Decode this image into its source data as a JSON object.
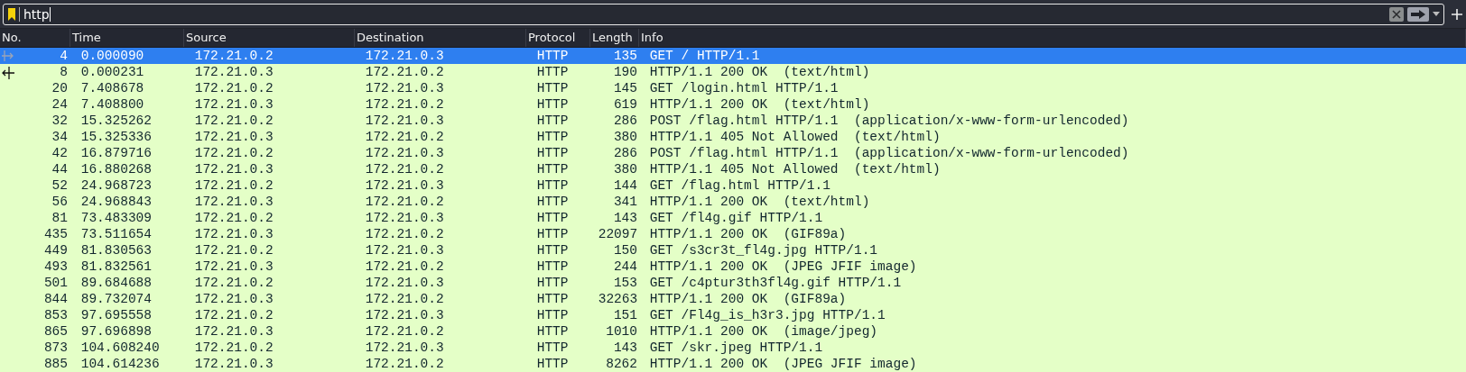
{
  "filter_bar": {
    "value": "http"
  },
  "table": {
    "columns": [
      "No.",
      "Time",
      "Source",
      "Destination",
      "Protocol",
      "Length",
      "Info"
    ],
    "rows": [
      {
        "selected": true,
        "kind": "request",
        "cells": [
          "4",
          "0.000090",
          "172.21.0.2",
          "172.21.0.3",
          "HTTP",
          "135",
          "GET / HTTP/1.1"
        ]
      },
      {
        "selected": false,
        "kind": "response",
        "cells": [
          "8",
          "0.000231",
          "172.21.0.3",
          "172.21.0.2",
          "HTTP",
          "190",
          "HTTP/1.1 200 OK  (text/html)"
        ]
      },
      {
        "selected": false,
        "cells": [
          "20",
          "7.408678",
          "172.21.0.2",
          "172.21.0.3",
          "HTTP",
          "145",
          "GET /login.html HTTP/1.1"
        ]
      },
      {
        "selected": false,
        "cells": [
          "24",
          "7.408800",
          "172.21.0.3",
          "172.21.0.2",
          "HTTP",
          "619",
          "HTTP/1.1 200 OK  (text/html)"
        ]
      },
      {
        "selected": false,
        "cells": [
          "32",
          "15.325262",
          "172.21.0.2",
          "172.21.0.3",
          "HTTP",
          "286",
          "POST /flag.html HTTP/1.1  (application/x-www-form-urlencoded)"
        ]
      },
      {
        "selected": false,
        "cells": [
          "34",
          "15.325336",
          "172.21.0.3",
          "172.21.0.2",
          "HTTP",
          "380",
          "HTTP/1.1 405 Not Allowed  (text/html)"
        ]
      },
      {
        "selected": false,
        "cells": [
          "42",
          "16.879716",
          "172.21.0.2",
          "172.21.0.3",
          "HTTP",
          "286",
          "POST /flag.html HTTP/1.1  (application/x-www-form-urlencoded)"
        ]
      },
      {
        "selected": false,
        "cells": [
          "44",
          "16.880268",
          "172.21.0.3",
          "172.21.0.2",
          "HTTP",
          "380",
          "HTTP/1.1 405 Not Allowed  (text/html)"
        ]
      },
      {
        "selected": false,
        "cells": [
          "52",
          "24.968723",
          "172.21.0.2",
          "172.21.0.3",
          "HTTP",
          "144",
          "GET /flag.html HTTP/1.1"
        ]
      },
      {
        "selected": false,
        "cells": [
          "56",
          "24.968843",
          "172.21.0.3",
          "172.21.0.2",
          "HTTP",
          "341",
          "HTTP/1.1 200 OK  (text/html)"
        ]
      },
      {
        "selected": false,
        "cells": [
          "81",
          "73.483309",
          "172.21.0.2",
          "172.21.0.3",
          "HTTP",
          "143",
          "GET /fl4g.gif HTTP/1.1"
        ]
      },
      {
        "selected": false,
        "cells": [
          "435",
          "73.511654",
          "172.21.0.3",
          "172.21.0.2",
          "HTTP",
          "22097",
          "HTTP/1.1 200 OK  (GIF89a)"
        ]
      },
      {
        "selected": false,
        "cells": [
          "449",
          "81.830563",
          "172.21.0.2",
          "172.21.0.3",
          "HTTP",
          "150",
          "GET /s3cr3t_fl4g.jpg HTTP/1.1"
        ]
      },
      {
        "selected": false,
        "cells": [
          "493",
          "81.832561",
          "172.21.0.3",
          "172.21.0.2",
          "HTTP",
          "244",
          "HTTP/1.1 200 OK  (JPEG JFIF image)"
        ]
      },
      {
        "selected": false,
        "cells": [
          "501",
          "89.684688",
          "172.21.0.2",
          "172.21.0.3",
          "HTTP",
          "153",
          "GET /c4ptur3th3fl4g.gif HTTP/1.1"
        ]
      },
      {
        "selected": false,
        "cells": [
          "844",
          "89.732074",
          "172.21.0.3",
          "172.21.0.2",
          "HTTP",
          "32263",
          "HTTP/1.1 200 OK  (GIF89a)"
        ]
      },
      {
        "selected": false,
        "cells": [
          "853",
          "97.695558",
          "172.21.0.2",
          "172.21.0.3",
          "HTTP",
          "151",
          "GET /Fl4g_is_h3r3.jpg HTTP/1.1"
        ]
      },
      {
        "selected": false,
        "cells": [
          "865",
          "97.696898",
          "172.21.0.3",
          "172.21.0.2",
          "HTTP",
          "1010",
          "HTTP/1.1 200 OK  (image/jpeg)"
        ]
      },
      {
        "selected": false,
        "cells": [
          "873",
          "104.608240",
          "172.21.0.2",
          "172.21.0.3",
          "HTTP",
          "143",
          "GET /skr.jpeg HTTP/1.1"
        ]
      },
      {
        "selected": false,
        "cells": [
          "885",
          "104.614236",
          "172.21.0.3",
          "172.21.0.2",
          "HTTP",
          "8262",
          "HTTP/1.1 200 OK  (JPEG JFIF image)"
        ]
      }
    ]
  }
}
